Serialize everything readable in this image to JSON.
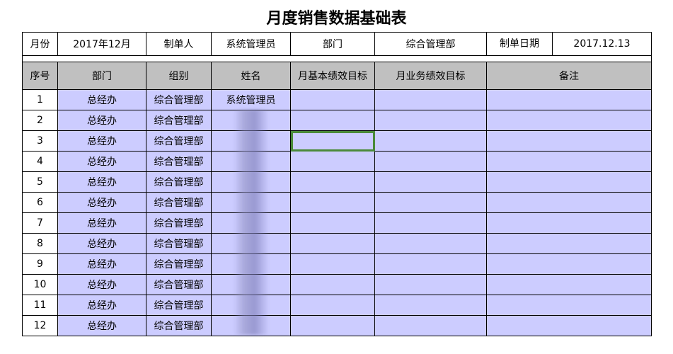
{
  "title": "月度销售数据基础表",
  "info": {
    "month_label": "月份",
    "month_value": "2017年12月",
    "maker_label": "制单人",
    "maker_value": "系统管理员",
    "dept_label": "部门",
    "dept_value": "综合管理部",
    "date_label": "制单日期",
    "date_value": "2017.12.13"
  },
  "headers": [
    "序号",
    "部门",
    "组别",
    "姓名",
    "月基本绩效目标",
    "月业务绩效目标",
    "备注"
  ],
  "rows": [
    {
      "no": "1",
      "dept": "总经办",
      "group": "综合管理部",
      "name": "系统管理员"
    },
    {
      "no": "2",
      "dept": "总经办",
      "group": "综合管理部",
      "name": ""
    },
    {
      "no": "3",
      "dept": "总经办",
      "group": "综合管理部",
      "name": ""
    },
    {
      "no": "4",
      "dept": "总经办",
      "group": "综合管理部",
      "name": ""
    },
    {
      "no": "5",
      "dept": "总经办",
      "group": "综合管理部",
      "name": ""
    },
    {
      "no": "6",
      "dept": "总经办",
      "group": "综合管理部",
      "name": ""
    },
    {
      "no": "7",
      "dept": "总经办",
      "group": "综合管理部",
      "name": ""
    },
    {
      "no": "8",
      "dept": "总经办",
      "group": "综合管理部",
      "name": ""
    },
    {
      "no": "9",
      "dept": "总经办",
      "group": "综合管理部",
      "name": ""
    },
    {
      "no": "10",
      "dept": "总经办",
      "group": "综合管理部",
      "name": ""
    },
    {
      "no": "11",
      "dept": "总经办",
      "group": "综合管理部",
      "name": ""
    },
    {
      "no": "12",
      "dept": "总经办",
      "group": "综合管理部",
      "name": ""
    }
  ],
  "colors": {
    "header_bg": "#c0c0c0",
    "row_bg": "#ccccff",
    "selection": "#4a8a3a"
  }
}
